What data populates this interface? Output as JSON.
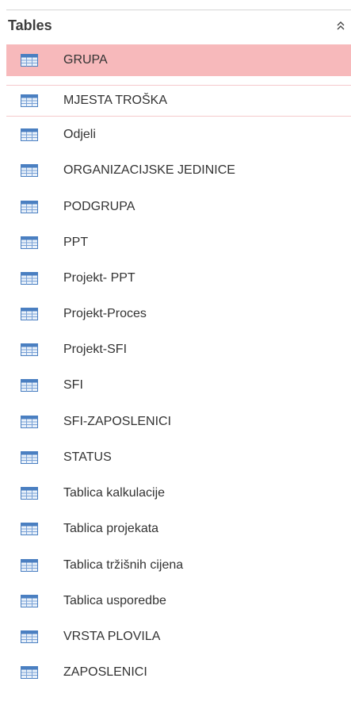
{
  "nav_pane": {
    "group_title": "Tables",
    "collapse_glyph": "double-chevron-up-icon",
    "selected_color": "#f7b9bb",
    "items": [
      {
        "label": "GRUPA",
        "icon": "table-icon"
      },
      {
        "label": "MJESTA TROŠKA",
        "icon": "table-icon"
      },
      {
        "label": "Odjeli",
        "icon": "table-icon"
      },
      {
        "label": "ORGANIZACIJSKE JEDINICE",
        "icon": "table-icon"
      },
      {
        "label": "PODGRUPA",
        "icon": "table-icon"
      },
      {
        "label": "PPT",
        "icon": "table-icon"
      },
      {
        "label": "Projekt- PPT",
        "icon": "table-icon"
      },
      {
        "label": "Projekt-Proces",
        "icon": "table-icon"
      },
      {
        "label": "Projekt-SFI",
        "icon": "table-icon"
      },
      {
        "label": "SFI",
        "icon": "table-icon"
      },
      {
        "label": "SFI-ZAPOSLENICI",
        "icon": "table-icon"
      },
      {
        "label": "STATUS",
        "icon": "table-icon"
      },
      {
        "label": "Tablica kalkulacije",
        "icon": "table-icon"
      },
      {
        "label": "Tablica projekata",
        "icon": "table-icon"
      },
      {
        "label": "Tablica tržišnih cijena",
        "icon": "table-icon"
      },
      {
        "label": "Tablica usporedbe",
        "icon": "table-icon"
      },
      {
        "label": "VRSTA PLOVILA",
        "icon": "table-icon"
      },
      {
        "label": "ZAPOSLENICI",
        "icon": "table-icon"
      }
    ]
  }
}
